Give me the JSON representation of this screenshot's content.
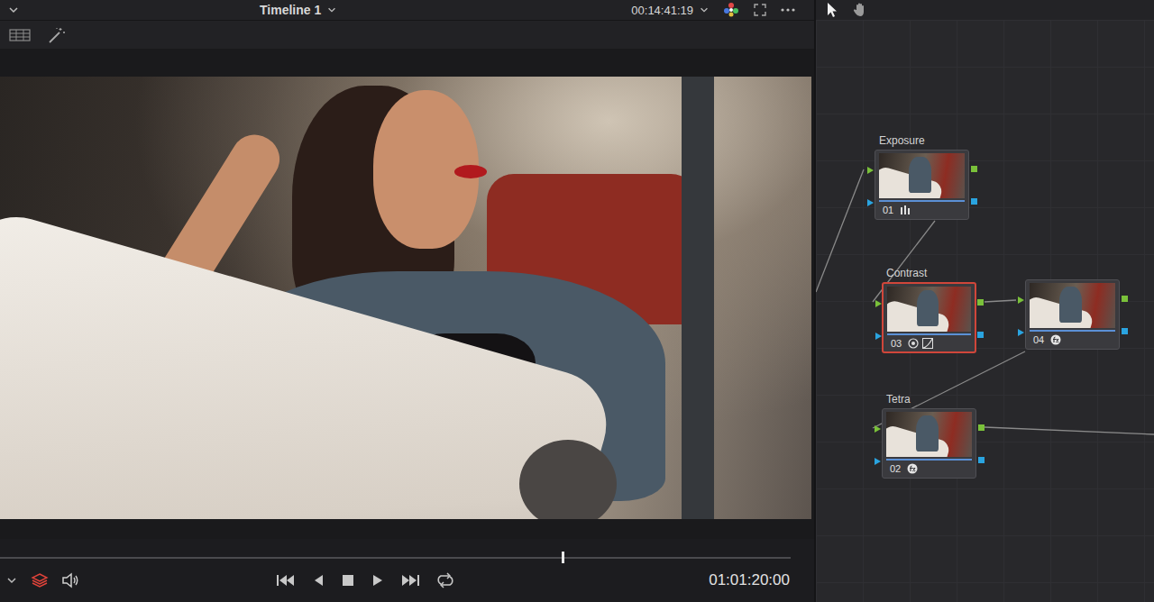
{
  "viewer": {
    "timeline_title": "Timeline 1",
    "source_timecode": "00:14:41:19",
    "record_timecode": "01:01:20:00",
    "playhead": {
      "level": 0.71
    },
    "layers_on": true
  },
  "node_tools": [
    {
      "kind": "pointer",
      "selected": true
    },
    {
      "kind": "hand",
      "selected": false
    }
  ],
  "nodes": [
    {
      "label": "Exposure",
      "number": "01",
      "kind": "primaries",
      "selected": false
    },
    {
      "label": "Contrast",
      "number": "03",
      "kind": "curves",
      "selected": true
    },
    {
      "number": "04",
      "kind": "fx",
      "selected": false
    },
    {
      "label": "Tetra",
      "number": "02",
      "kind": "fx",
      "selected": false
    }
  ]
}
